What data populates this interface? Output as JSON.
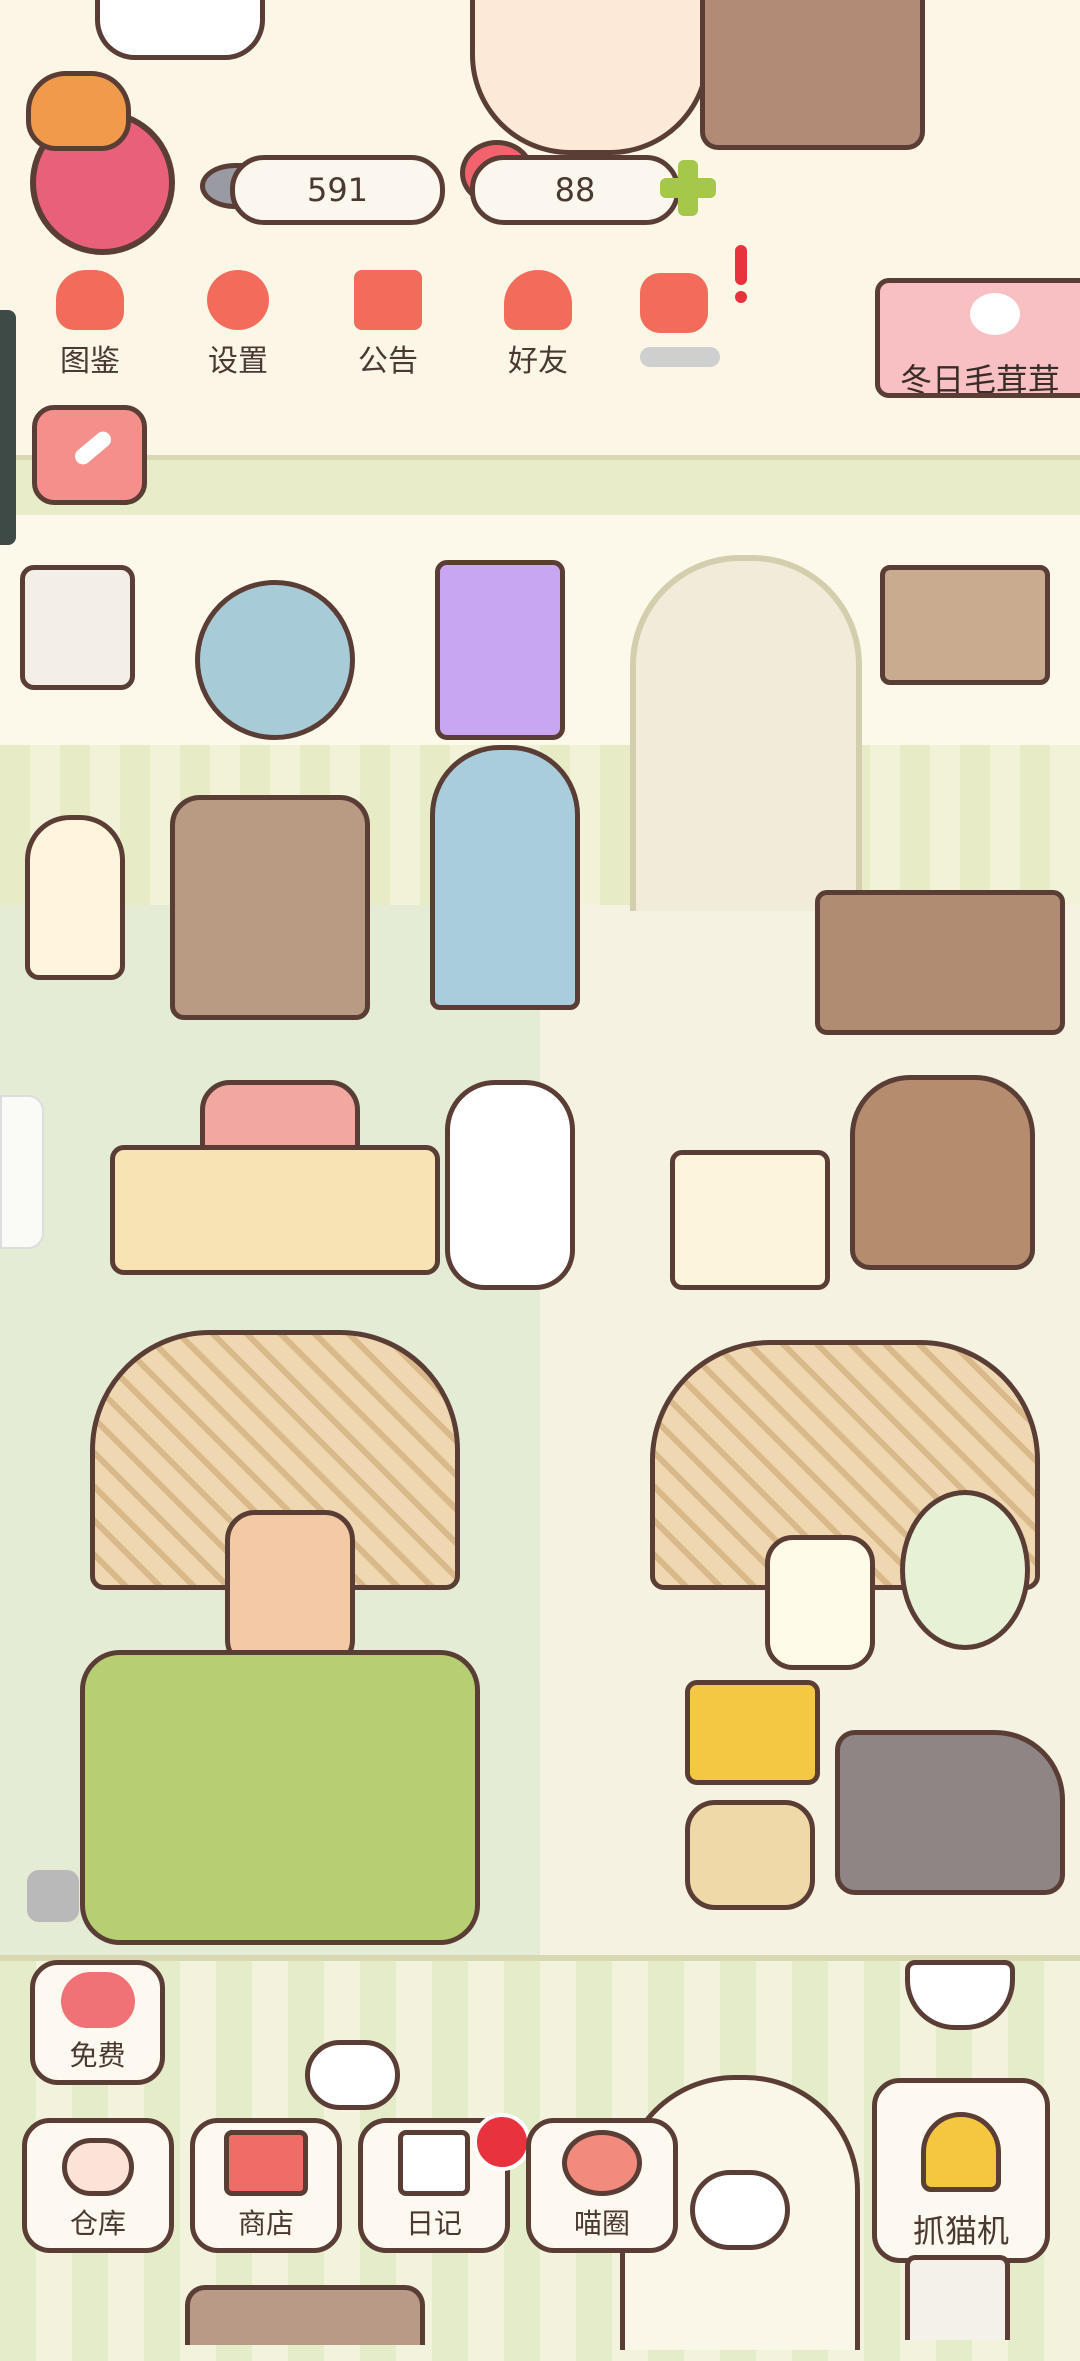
{
  "hud": {
    "fish_count": "591",
    "heart_count": "88",
    "event_banner": "冬日毛茸茸"
  },
  "menu": {
    "collection": "图鉴",
    "settings": "设置",
    "notice": "公告",
    "friends": "好友"
  },
  "bottom": {
    "free": "免费",
    "storage": "仓库",
    "shop": "商店",
    "diary": "日记",
    "circle": "喵圈",
    "claw": "抓猫机"
  },
  "colors": {
    "accent": "#f26b5b",
    "outline": "#5a3e36",
    "wall": "#fbf6e6",
    "notify": "#e8323e"
  }
}
